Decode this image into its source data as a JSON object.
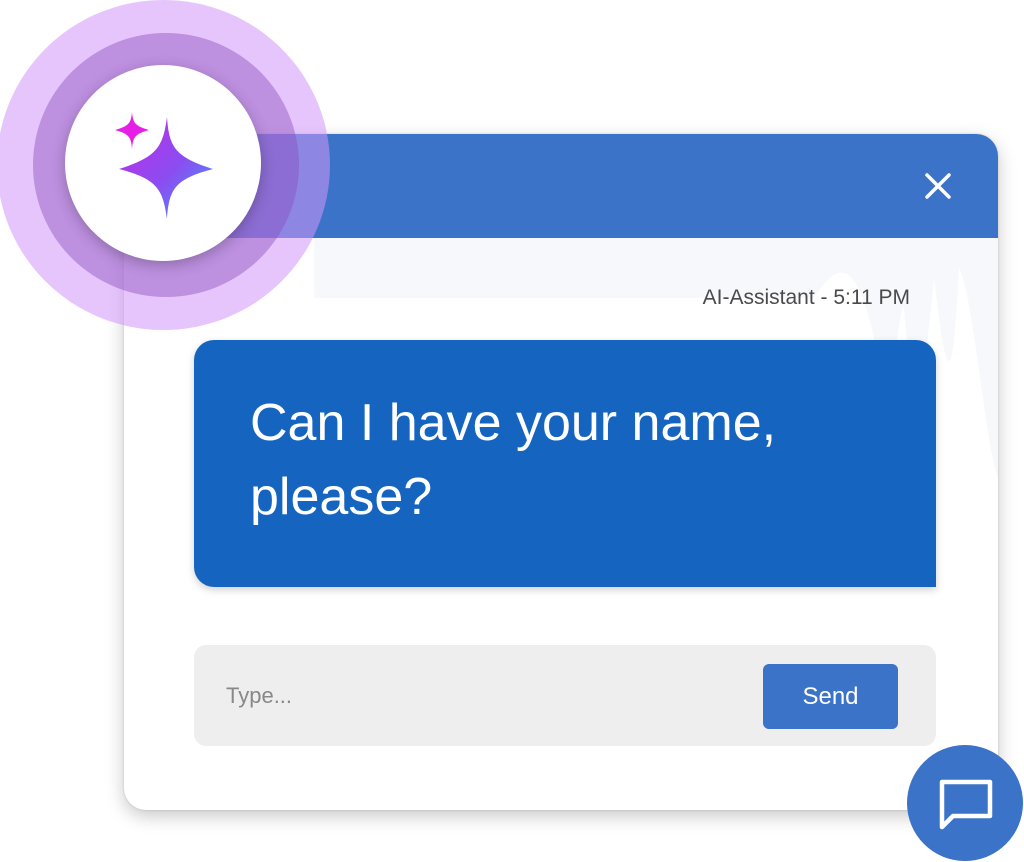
{
  "chat": {
    "meta": "AI-Assistant - 5:11 PM",
    "message": "Can I have your name, please?",
    "input_placeholder": "Type...",
    "send_label": "Send"
  },
  "colors": {
    "header": "#3B73C8",
    "bubble": "#1565C0",
    "input_bg": "#EEEEEE",
    "send_button": "#3B73C8",
    "launcher": "#3B73C8",
    "glow": "#D196FA"
  },
  "icons": {
    "close": "close-icon",
    "sparkle": "sparkle-icon",
    "chat": "chat-bubble-icon"
  }
}
